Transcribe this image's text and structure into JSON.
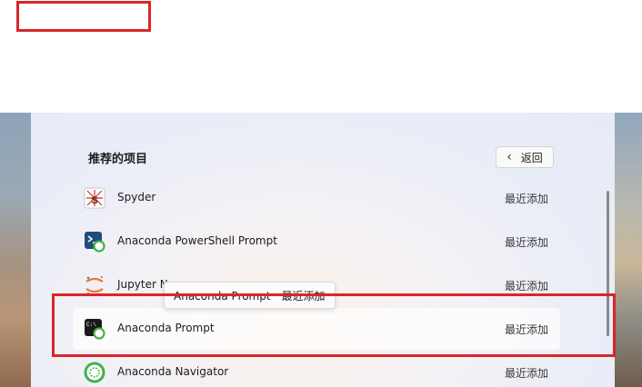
{
  "panel": {
    "title": "推荐的项目",
    "back_label": "返回"
  },
  "items": [
    {
      "name": "Spyder",
      "meta": "最近添加",
      "icon": "spyder-icon"
    },
    {
      "name": "Anaconda PowerShell Prompt",
      "meta": "最近添加",
      "icon": "powershell-prompt-icon"
    },
    {
      "name": "Jupyter N",
      "meta": "最近添加",
      "icon": "jupyter-icon"
    },
    {
      "name": "Anaconda Prompt",
      "meta": "最近添加",
      "icon": "anaconda-prompt-icon"
    },
    {
      "name": "Anaconda Navigator",
      "meta": "最近添加",
      "icon": "anaconda-navigator-icon"
    }
  ],
  "tooltip": {
    "text": "Anaconda Prompt　最近添加"
  },
  "colors": {
    "annotation_red": "#d9262a",
    "anaconda_green": "#43b049"
  }
}
